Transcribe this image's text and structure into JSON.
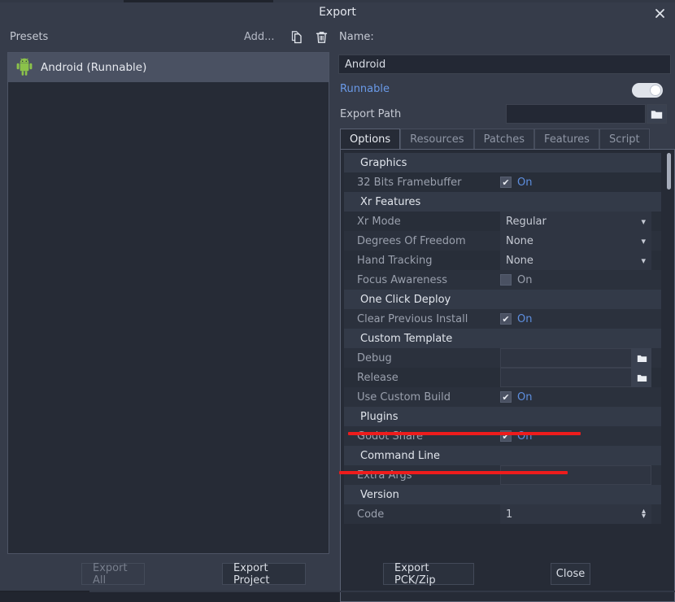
{
  "window": {
    "title": "Export",
    "close_icon": "close-icon"
  },
  "presets": {
    "header_label": "Presets",
    "add_label": "Add...",
    "duplicate_icon": "duplicate-icon",
    "delete_icon": "trash-icon",
    "items": [
      {
        "label": "Android (Runnable)",
        "icon": "android-icon",
        "selected": true
      }
    ]
  },
  "preset_detail": {
    "name_label": "Name:",
    "name_value": "Android",
    "runnable_label": "Runnable",
    "runnable_on": true,
    "export_path_label": "Export Path",
    "export_path_value": "",
    "folder_icon": "folder-icon"
  },
  "tabs": [
    {
      "label": "Options",
      "active": true
    },
    {
      "label": "Resources",
      "active": false
    },
    {
      "label": "Patches",
      "active": false
    },
    {
      "label": "Features",
      "active": false
    },
    {
      "label": "Script",
      "active": false
    }
  ],
  "properties": [
    {
      "kind": "section",
      "label": "Graphics"
    },
    {
      "kind": "checkbox",
      "label": "32 Bits Framebuffer",
      "value": "On",
      "checked": true
    },
    {
      "kind": "section",
      "label": "Xr Features"
    },
    {
      "kind": "dropdown",
      "label": "Xr Mode",
      "value": "Regular"
    },
    {
      "kind": "dropdown",
      "label": "Degrees Of Freedom",
      "value": "None"
    },
    {
      "kind": "dropdown",
      "label": "Hand Tracking",
      "value": "None"
    },
    {
      "kind": "checkbox",
      "label": "Focus Awareness",
      "value": "On",
      "checked": false
    },
    {
      "kind": "section",
      "label": "One Click Deploy"
    },
    {
      "kind": "checkbox",
      "label": "Clear Previous Install",
      "value": "On",
      "checked": true
    },
    {
      "kind": "section",
      "label": "Custom Template"
    },
    {
      "kind": "path",
      "label": "Debug",
      "value": ""
    },
    {
      "kind": "path",
      "label": "Release",
      "value": ""
    },
    {
      "kind": "checkbox",
      "label": "Use Custom Build",
      "value": "On",
      "checked": true
    },
    {
      "kind": "section",
      "label": "Plugins"
    },
    {
      "kind": "checkbox",
      "label": "Godot Share",
      "value": "On",
      "checked": true
    },
    {
      "kind": "section",
      "label": "Command Line"
    },
    {
      "kind": "text",
      "label": "Extra Args",
      "value": ""
    },
    {
      "kind": "section",
      "label": "Version"
    },
    {
      "kind": "spin",
      "label": "Code",
      "value": "1"
    }
  ],
  "annotations": [
    {
      "name": "highlight-use-custom-build",
      "color": "#ee1c1c"
    },
    {
      "name": "highlight-godot-share",
      "color": "#ee1c1c"
    }
  ],
  "footer": {
    "export_all": "Export All",
    "export_all_disabled": true,
    "export_project": "Export Project",
    "export_pck_zip": "Export PCK/Zip",
    "close": "Close"
  },
  "colors": {
    "dialog_bg": "#363c4a",
    "panel_bg": "#262b36",
    "row_bg": "#2b313d",
    "section_bg": "#333a48",
    "accent_blue": "#5e8fe0",
    "link_blue": "#6a9ae8",
    "annotation_red": "#ee1c1c",
    "android_green": "#8bc24a"
  }
}
